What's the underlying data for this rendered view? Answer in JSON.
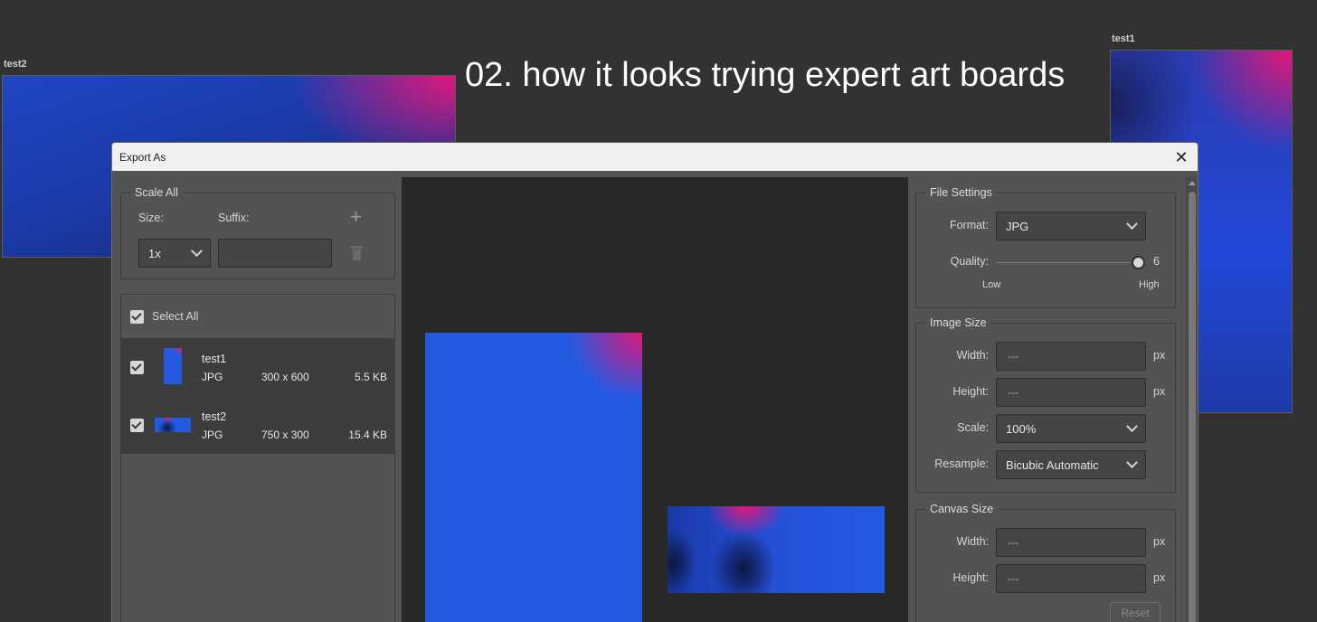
{
  "canvas": {
    "artboards": [
      {
        "label": "test2"
      },
      {
        "label": "test1"
      }
    ],
    "caption": "02. how it looks trying expert art boards"
  },
  "dialog": {
    "title": "Export As",
    "scale_all": {
      "legend": "Scale All",
      "size_label": "Size:",
      "suffix_label": "Suffix:",
      "size_value": "1x",
      "suffix_value": ""
    },
    "list": {
      "select_all": "Select All",
      "items": [
        {
          "name": "test1",
          "format": "JPG",
          "dimensions": "300 x 600",
          "filesize": "5.5 KB"
        },
        {
          "name": "test2",
          "format": "JPG",
          "dimensions": "750 x 300",
          "filesize": "15.4 KB"
        }
      ]
    },
    "file_settings": {
      "legend": "File Settings",
      "format_label": "Format:",
      "format_value": "JPG",
      "quality_label": "Quality:",
      "quality_value": "6",
      "quality_fraction": 0.95,
      "low_label": "Low",
      "high_label": "High"
    },
    "image_size": {
      "legend": "Image Size",
      "width_label": "Width:",
      "width_value": "---",
      "height_label": "Height:",
      "height_value": "---",
      "unit": "px",
      "scale_label": "Scale:",
      "scale_value": "100%",
      "resample_label": "Resample:",
      "resample_value": "Bicubic Automatic"
    },
    "canvas_size": {
      "legend": "Canvas Size",
      "width_label": "Width:",
      "width_value": "---",
      "height_label": "Height:",
      "height_value": "---",
      "unit": "px",
      "reset_label": "Reset"
    }
  }
}
